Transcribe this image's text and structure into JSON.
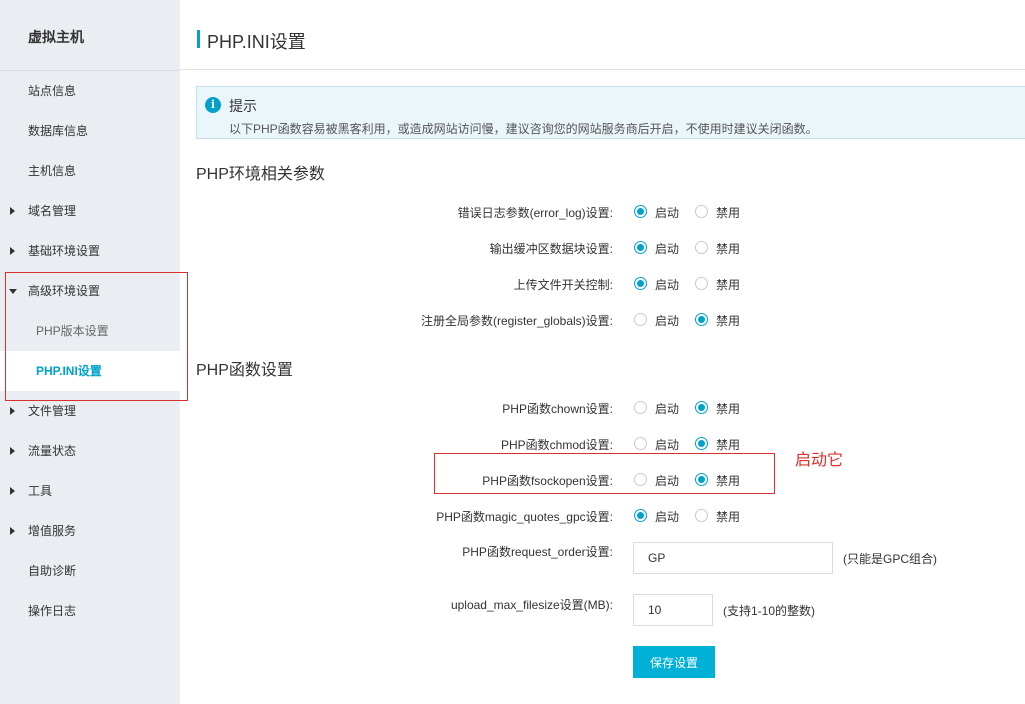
{
  "sidebar": {
    "title": "虚拟主机",
    "items": [
      {
        "label": "站点信息"
      },
      {
        "label": "数据库信息"
      },
      {
        "label": "主机信息"
      },
      {
        "label": "域名管理"
      },
      {
        "label": "基础环境设置"
      },
      {
        "label": "高级环境设置"
      },
      {
        "label": "PHP版本设置"
      },
      {
        "label": "PHP.INI设置"
      },
      {
        "label": "文件管理"
      },
      {
        "label": "流量状态"
      },
      {
        "label": "工具"
      },
      {
        "label": "增值服务"
      },
      {
        "label": "自助诊断"
      },
      {
        "label": "操作日志"
      }
    ]
  },
  "header": {
    "title": "PHP.INI设置"
  },
  "tip": {
    "icon": "info-icon",
    "title": "提示",
    "text": "以下PHP函数容易被黑客利用，或造成网站访问慢，建议咨询您的网站服务商后开启，不使用时建议关闭函数。"
  },
  "env_section": {
    "title": "PHP环境相关参数",
    "rows": [
      {
        "label": "错误日志参数(error_log)设置:",
        "selected": "enable"
      },
      {
        "label": "输出缓冲区数据块设置:",
        "selected": "enable"
      },
      {
        "label": "上传文件开关控制:",
        "selected": "enable"
      },
      {
        "label": "注册全局参数(register_globals)设置:",
        "selected": "disable"
      }
    ]
  },
  "func_section": {
    "title": "PHP函数设置",
    "rows": [
      {
        "label": "PHP函数chown设置:",
        "selected": "disable"
      },
      {
        "label": "PHP函数chmod设置:",
        "selected": "disable"
      },
      {
        "label": "PHP函数fsockopen设置:",
        "selected": "disable"
      },
      {
        "label": "PHP函数magic_quotes_gpc设置:",
        "selected": "enable"
      }
    ]
  },
  "options": {
    "enable": "启动",
    "disable": "禁用"
  },
  "request_order": {
    "label": "PHP函数request_order设置:",
    "value": "GP",
    "hint": "(只能是GPC组合)"
  },
  "upload_max": {
    "label": "upload_max_filesize设置(MB):",
    "value": "10",
    "hint": "(支持1-10的整数)"
  },
  "save_label": "保存设置",
  "annotation": "启动它",
  "colors": {
    "accent": "#00a2ca",
    "button": "#00b0d6",
    "annotation": "#d9302b",
    "sidebar_bg": "#eaedf1"
  }
}
